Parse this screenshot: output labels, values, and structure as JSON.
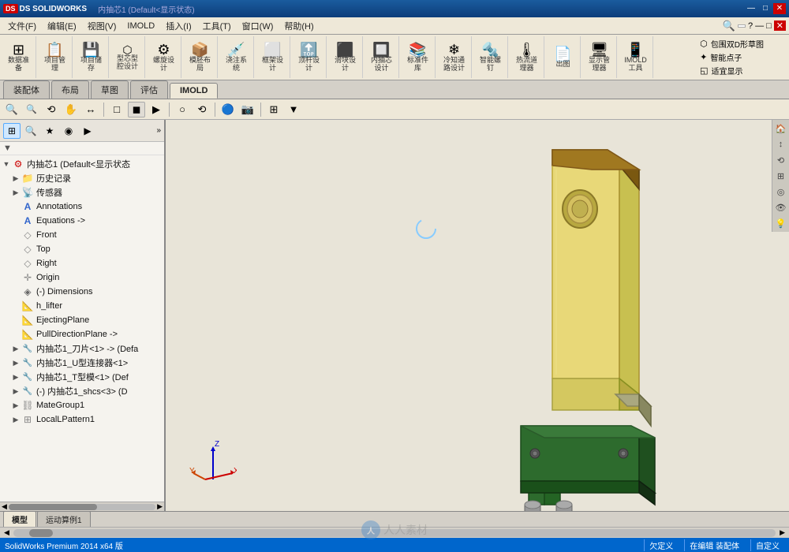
{
  "app": {
    "title": "SOLIDWORKS Premium 2014 x64 版",
    "logo": "DS SOLIDWORKS",
    "document_title": "内抽芯1 (Default<显示状态)"
  },
  "titlebar": {
    "controls": [
      "—",
      "□",
      "✕"
    ],
    "window_buttons": [
      "minimize",
      "maximize",
      "close"
    ]
  },
  "menubar": {
    "items": [
      "文件(F)",
      "编辑(E)",
      "视图(V)",
      "IMOLD",
      "插入(I)",
      "工具(T)",
      "窗口(W)",
      "帮助(H)"
    ]
  },
  "toolbar": {
    "groups": [
      {
        "icon": "⊞",
        "label": "数据准备",
        "name": "data-prep"
      },
      {
        "icon": "📋",
        "label": "项目管理",
        "name": "project-mgr"
      },
      {
        "icon": "💾",
        "label": "项目储存",
        "name": "project-save"
      },
      {
        "icon": "⬡",
        "label": "型芯型腔设计",
        "name": "core-cavity"
      },
      {
        "icon": "⚙",
        "label": "螺旋设计",
        "name": "helix"
      },
      {
        "icon": "📦",
        "label": "模胚布局",
        "name": "mold-layout"
      },
      {
        "icon": "💉",
        "label": "浇注系统",
        "name": "injection"
      },
      {
        "icon": "⬜",
        "label": "框架设计",
        "name": "frame"
      },
      {
        "icon": "🔝",
        "label": "顶杆设计",
        "name": "ejector"
      },
      {
        "icon": "⬛",
        "label": "滑块设计",
        "name": "slide"
      },
      {
        "icon": "🔲",
        "label": "内抽芯设计",
        "name": "inner-core"
      },
      {
        "icon": "📚",
        "label": "标准件库",
        "name": "std-lib"
      },
      {
        "icon": "❄",
        "label": "冷知通路设计",
        "name": "cooling"
      },
      {
        "icon": "🔩",
        "label": "智能螺钉",
        "name": "smart-screw"
      },
      {
        "icon": "🌡",
        "label": "热流道理器",
        "name": "hot-runner"
      },
      {
        "icon": "📄",
        "label": "出图",
        "name": "drawing"
      },
      {
        "icon": "🖥",
        "label": "显示管理器",
        "name": "display-mgr"
      },
      {
        "icon": "📱",
        "label": "IMOLD工具",
        "name": "imold-tools"
      }
    ],
    "right_items": [
      {
        "label": "包围双D形草图",
        "name": "surround-sketch"
      },
      {
        "label": "智能点子",
        "name": "smart-points"
      },
      {
        "label": "适宜显示",
        "name": "fit-display"
      }
    ]
  },
  "tabs": {
    "items": [
      "装配体",
      "布局",
      "草图",
      "评估",
      "IMOLD"
    ],
    "active": "IMOLD"
  },
  "secondary_toolbar": {
    "buttons": [
      "🔍+",
      "🔍-",
      "⟲",
      "✋",
      "↔",
      "□",
      "▶",
      "○",
      "⟲2",
      "🔵",
      "📷",
      "⊞",
      "▼"
    ]
  },
  "feature_panel": {
    "toolbar_buttons": [
      "⊞",
      "🔍",
      "★",
      "◉",
      "▶"
    ],
    "filter_icon": "▼",
    "tree": [
      {
        "level": 0,
        "expand": "▼",
        "icon": "⚙",
        "label": "内抽芯1 (Default<显示状态>",
        "name": "root-assembly"
      },
      {
        "level": 1,
        "expand": "▶",
        "icon": "📁",
        "label": "历史记录",
        "name": "history"
      },
      {
        "level": 1,
        "expand": "▶",
        "icon": "📡",
        "label": "传感器",
        "name": "sensors"
      },
      {
        "level": 1,
        "expand": "",
        "icon": "A",
        "label": "Annotations",
        "name": "annotations"
      },
      {
        "level": 1,
        "expand": "",
        "icon": "A",
        "label": "Equations ->",
        "name": "equations"
      },
      {
        "level": 1,
        "expand": "",
        "icon": "◇",
        "label": "Front",
        "name": "plane-front"
      },
      {
        "level": 1,
        "expand": "",
        "icon": "◇",
        "label": "Top",
        "name": "plane-top"
      },
      {
        "level": 1,
        "expand": "",
        "icon": "◇",
        "label": "Right",
        "name": "plane-right"
      },
      {
        "level": 1,
        "expand": "",
        "icon": "✛",
        "label": "Origin",
        "name": "origin"
      },
      {
        "level": 1,
        "expand": "",
        "icon": "◈",
        "label": "(-) Dimensions",
        "name": "dimensions"
      },
      {
        "level": 1,
        "expand": "",
        "icon": "📐",
        "label": "h_lifter",
        "name": "h-lifter"
      },
      {
        "level": 1,
        "expand": "",
        "icon": "📐",
        "label": "EjectingPlane",
        "name": "ejecting-plane"
      },
      {
        "level": 1,
        "expand": "",
        "icon": "📐",
        "label": "PullDirectionPlane ->",
        "name": "pull-dir-plane"
      },
      {
        "level": 1,
        "expand": "▶",
        "icon": "🔧",
        "label": "内抽芯1_刀片<1> -> (Defa",
        "name": "inner-core-blade"
      },
      {
        "level": 1,
        "expand": "▶",
        "icon": "🔧",
        "label": "内抽芯1_U型连接器<1>",
        "name": "inner-core-u"
      },
      {
        "level": 1,
        "expand": "▶",
        "icon": "🔧",
        "label": "内抽芯1_T型模<1> (Def",
        "name": "inner-core-t"
      },
      {
        "level": 1,
        "expand": "▶",
        "icon": "🔧",
        "label": "(-) 内抽芯1_shcs<3> (D",
        "name": "inner-core-shcs"
      },
      {
        "level": 1,
        "expand": "▶",
        "icon": "⛓",
        "label": "MateGroup1",
        "name": "mate-group"
      },
      {
        "level": 1,
        "expand": "▶",
        "icon": "⊞",
        "label": "LocalLPattern1",
        "name": "local-pattern"
      }
    ]
  },
  "viewport": {
    "background_color": "#e8e4d8",
    "model_description": "3D assembly view of inner core mechanism"
  },
  "view_toolbar": {
    "buttons": [
      "🏠",
      "↕",
      "⟲",
      "⊞",
      "◎",
      "👁",
      "💡"
    ]
  },
  "bottom_tabs": {
    "items": [
      "模型",
      "运动算例1"
    ],
    "active": "模型"
  },
  "statusbar": {
    "left_text": "SolidWorks Premium 2014 x64 版",
    "status": "欠定义",
    "mode": "在编辑 装配体",
    "right": "自定义"
  },
  "coordinate_axes": {
    "x_color": "#cc0000",
    "y_color": "#00aa00",
    "z_color": "#0000cc"
  }
}
